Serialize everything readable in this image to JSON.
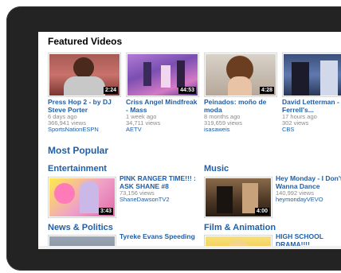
{
  "featured": {
    "title": "Featured Videos",
    "videos": [
      {
        "title": "Press Hop 2 - by DJ Steve Porter",
        "age": "6 days ago",
        "views": "366,941 views",
        "channel": "SportsNationESPN",
        "duration": "2:24"
      },
      {
        "title": "Criss Angel Mindfreak - Mass",
        "age": "1 week ago",
        "views": "34,711 views",
        "channel": "AETV",
        "duration": "44:53"
      },
      {
        "title": "Peinados: moño de moda",
        "age": "8 months ago",
        "views": "319,659 views",
        "channel": "isasaweis",
        "duration": "4:28"
      },
      {
        "title": "David Letterman - Will Ferrell's...",
        "age": "17 hours ago",
        "views": "302 views",
        "channel": "CBS",
        "duration": ""
      }
    ]
  },
  "popular": {
    "title": "Most Popular",
    "categories": [
      {
        "name": "Entertainment",
        "video_title": "PINK RANGER TIME!!! : ASK SHANE #8",
        "views": "73,156 views",
        "channel": "ShaneDawsonTV2",
        "duration": "3:43"
      },
      {
        "name": "Music",
        "video_title": "Hey Monday - I Don't Wanna Dance",
        "views": "140,992 views",
        "channel": "heymondayVEVO",
        "duration": "4:00"
      },
      {
        "name": "News & Politics",
        "video_title": "Tyreke Evans Speeding",
        "views": "",
        "channel": "",
        "duration": ""
      },
      {
        "name": "Film & Animation",
        "video_title": "HIGH SCHOOL DRAMA!!!!",
        "views": "",
        "channel": "",
        "duration": ""
      }
    ]
  }
}
